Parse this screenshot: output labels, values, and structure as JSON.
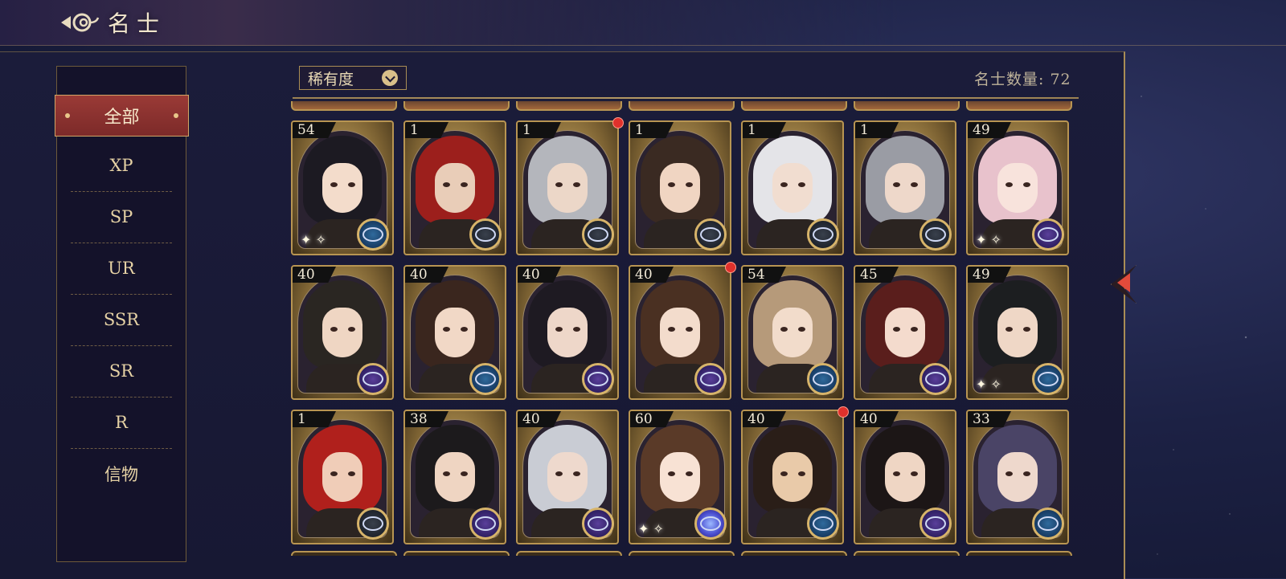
{
  "header": {
    "title": "名士"
  },
  "sidebar": {
    "active": "全部",
    "items": [
      "XP",
      "SP",
      "UR",
      "SSR",
      "SR",
      "R",
      "信物"
    ]
  },
  "toolbar": {
    "filter_label": "稀有度",
    "count_label": "名士数量: 72"
  },
  "cards": [
    {
      "level": "54",
      "hair": "#1c1a22",
      "skin": "#f3dccb",
      "badge": "blue",
      "sparkle": true,
      "dot": false
    },
    {
      "level": "1",
      "hair": "#9c1f1c",
      "skin": "#e9cdb8",
      "badge": "gray",
      "sparkle": false,
      "dot": false
    },
    {
      "level": "1",
      "hair": "#b4b6bc",
      "skin": "#ecd7c8",
      "badge": "gray",
      "sparkle": false,
      "dot": true
    },
    {
      "level": "1",
      "hair": "#3a2a22",
      "skin": "#f0d5c2",
      "badge": "gray",
      "sparkle": false,
      "dot": false
    },
    {
      "level": "1",
      "hair": "#e4e4e8",
      "skin": "#f1ddd0",
      "badge": "gray",
      "sparkle": false,
      "dot": false
    },
    {
      "level": "1",
      "hair": "#9a9ca4",
      "skin": "#eed8ca",
      "badge": "gray",
      "sparkle": false,
      "dot": false
    },
    {
      "level": "49",
      "hair": "#e8c2cc",
      "skin": "#f8e3dc",
      "badge": "purple",
      "sparkle": true,
      "dot": false
    },
    {
      "level": "40",
      "hair": "#2a2622",
      "skin": "#efd6c3",
      "badge": "purple",
      "sparkle": false,
      "dot": false
    },
    {
      "level": "40",
      "hair": "#3a261e",
      "skin": "#f1d8c6",
      "badge": "blue",
      "sparkle": false,
      "dot": false
    },
    {
      "level": "40",
      "hair": "#1e1a22",
      "skin": "#eed7c9",
      "badge": "purple",
      "sparkle": false,
      "dot": false
    },
    {
      "level": "40",
      "hair": "#4a3022",
      "skin": "#f3dccc",
      "badge": "purple",
      "sparkle": false,
      "dot": true
    },
    {
      "level": "54",
      "hair": "#b69a7a",
      "skin": "#f2dccb",
      "badge": "blue",
      "sparkle": false,
      "dot": false
    },
    {
      "level": "45",
      "hair": "#5a1e1c",
      "skin": "#f4dbcd",
      "badge": "purple",
      "sparkle": false,
      "dot": false
    },
    {
      "level": "49",
      "hair": "#1c1e20",
      "skin": "#efd7c6",
      "badge": "blue",
      "sparkle": true,
      "dot": false
    },
    {
      "level": "1",
      "hair": "#b0201c",
      "skin": "#f0cdb8",
      "badge": "gray",
      "sparkle": false,
      "dot": false
    },
    {
      "level": "38",
      "hair": "#1c1a1c",
      "skin": "#efd5c2",
      "badge": "purple",
      "sparkle": false,
      "dot": false
    },
    {
      "level": "40",
      "hair": "#c9ccd4",
      "skin": "#eed9cd",
      "badge": "purple",
      "sparkle": false,
      "dot": false
    },
    {
      "level": "60",
      "hair": "#5a3a28",
      "skin": "#f8e2d4",
      "badge": "orb",
      "sparkle": true,
      "dot": false
    },
    {
      "level": "40",
      "hair": "#2a1e18",
      "skin": "#e9caa9",
      "badge": "blue",
      "sparkle": false,
      "dot": true
    },
    {
      "level": "40",
      "hair": "#1c1616",
      "skin": "#efd6c4",
      "badge": "purple",
      "sparkle": false,
      "dot": false
    },
    {
      "level": "33",
      "hair": "#4a4466",
      "skin": "#eed8cc",
      "badge": "blue",
      "sparkle": false,
      "dot": false
    }
  ],
  "colors": {
    "accent": "#7c2a29",
    "gold": "#b89552",
    "panel": "#171833",
    "new_dot": "#e0312c"
  }
}
